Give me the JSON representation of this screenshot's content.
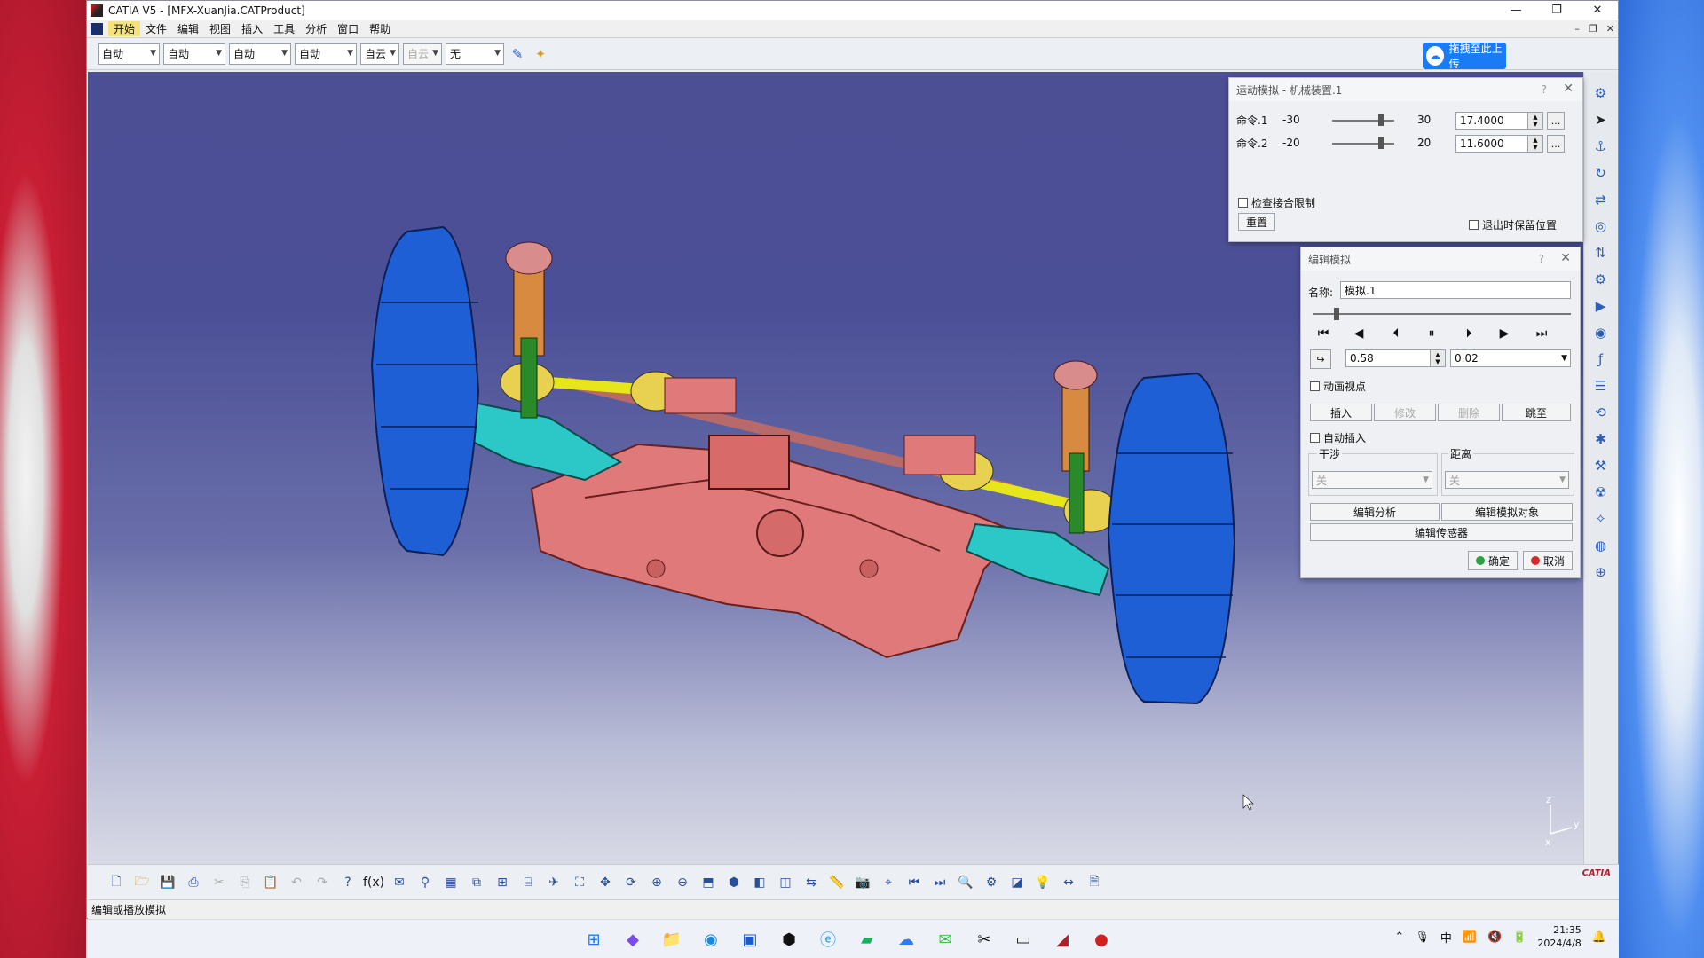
{
  "window": {
    "title": "CATIA V5 - [MFX-XuanJia.CATProduct]"
  },
  "menu": [
    "开始",
    "文件",
    "编辑",
    "视图",
    "插入",
    "工具",
    "分析",
    "窗口",
    "帮助"
  ],
  "toolbar": {
    "combos": [
      "自动",
      "自动",
      "自动",
      "自动",
      "自云",
      "自云",
      "无"
    ],
    "upload_label": "拖拽至此上传"
  },
  "motion_dialog": {
    "title": "运动模拟 - 机械装置.1",
    "commands": [
      {
        "label": "命令.1",
        "min": "-30",
        "max": "30",
        "value": "17.4000",
        "level": 0.79
      },
      {
        "label": "命令.2",
        "min": "-20",
        "max": "20",
        "value": "11.6000",
        "level": 0.79
      }
    ],
    "check_limits_label": "检查接合限制",
    "reset_label": "重置",
    "keep_position_label": "退出时保留位置"
  },
  "edit_sim_dialog": {
    "title": "编辑模拟",
    "name_label": "名称:",
    "name_value": "模拟.1",
    "timeline_level": 0.09,
    "step_value": "0.58",
    "interval_value": "0.02",
    "animate_viewpoint_label": "动画视点",
    "insert_label": "插入",
    "modify_label": "修改",
    "delete_label": "删除",
    "jump_label": "跳至",
    "auto_insert_label": "自动插入",
    "interference_label": "干涉",
    "interference_value": "关",
    "distance_label": "距离",
    "distance_value": "关",
    "edit_analysis_label": "编辑分析",
    "edit_sim_objects_label": "编辑模拟对象",
    "edit_sensors_label": "编辑传感器",
    "ok_label": "确定",
    "cancel_label": "取消"
  },
  "status_text": "编辑或播放模拟",
  "compass": {
    "z": "z",
    "y": "y",
    "x": "x"
  },
  "logo_text": "CATIA",
  "taskbar": {
    "time": "21:35",
    "date": "2024/4/8",
    "ime": "中"
  },
  "colors": {
    "viewport_top": "#4d4f94",
    "upload_blue": "#1a7cf5",
    "tire_blue": "#1f5fd6",
    "subframe_pink": "#e07a7a"
  }
}
